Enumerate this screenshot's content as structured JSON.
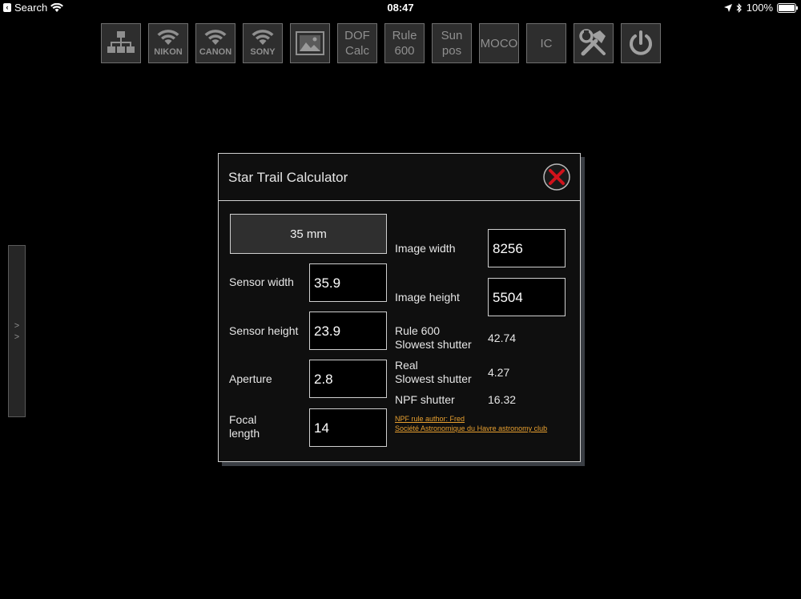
{
  "status_bar": {
    "back_label": "Search",
    "time": "08:47",
    "battery": "100%"
  },
  "toolbar": {
    "buttons": [
      {
        "id": "network",
        "icon": "network-tree-icon"
      },
      {
        "id": "nikon",
        "icon": "wifi-icon",
        "label": "NIKON"
      },
      {
        "id": "canon",
        "icon": "wifi-icon",
        "label": "CANON"
      },
      {
        "id": "sony",
        "icon": "wifi-icon",
        "label": "SONY"
      },
      {
        "id": "gallery",
        "icon": "image-icon"
      },
      {
        "id": "dof",
        "label_line1": "DOF",
        "label_line2": "Calc"
      },
      {
        "id": "rule600",
        "label_line1": "Rule",
        "label_line2": "600"
      },
      {
        "id": "sunpos",
        "label_line1": "Sun",
        "label_line2": "pos"
      },
      {
        "id": "moco",
        "label": "MOCO"
      },
      {
        "id": "ic",
        "label": "IC"
      },
      {
        "id": "tools",
        "icon": "tools-icon"
      },
      {
        "id": "power",
        "icon": "power-icon"
      }
    ]
  },
  "side_handle": {
    "glyphs": [
      ">",
      ">"
    ]
  },
  "dialog": {
    "title": "Star Trail Calculator",
    "preset_button": "35 mm",
    "fields": {
      "sensor_width": {
        "label": "Sensor width",
        "value": "35.9"
      },
      "sensor_height": {
        "label": "Sensor height",
        "value": "23.9"
      },
      "aperture": {
        "label": "Aperture",
        "value": "2.8"
      },
      "focal_length": {
        "label_line1": "Focal",
        "label_line2": "length",
        "value": "14"
      },
      "image_width": {
        "label": "Image width",
        "value": "8256"
      },
      "image_height": {
        "label": "Image height",
        "value": "5504"
      }
    },
    "results": {
      "rule600": {
        "label_line1": "Rule 600",
        "label_line2": "Slowest shutter",
        "value": "42.74"
      },
      "real": {
        "label_line1": "Real",
        "label_line2": "Slowest shutter",
        "value": "4.27"
      },
      "npf": {
        "label": "NPF shutter",
        "value": "16.32"
      }
    },
    "credit_line1": "NPF rule author: Fred",
    "credit_line2": "Société Astronomique du Havre astronomy club"
  },
  "colors": {
    "background": "#000000",
    "panel": "#0f0f0f",
    "border": "#cfcfcf",
    "toolbar_gray": "#8f8f8f",
    "link": "#e8a030",
    "close_red": "#d0121b"
  }
}
